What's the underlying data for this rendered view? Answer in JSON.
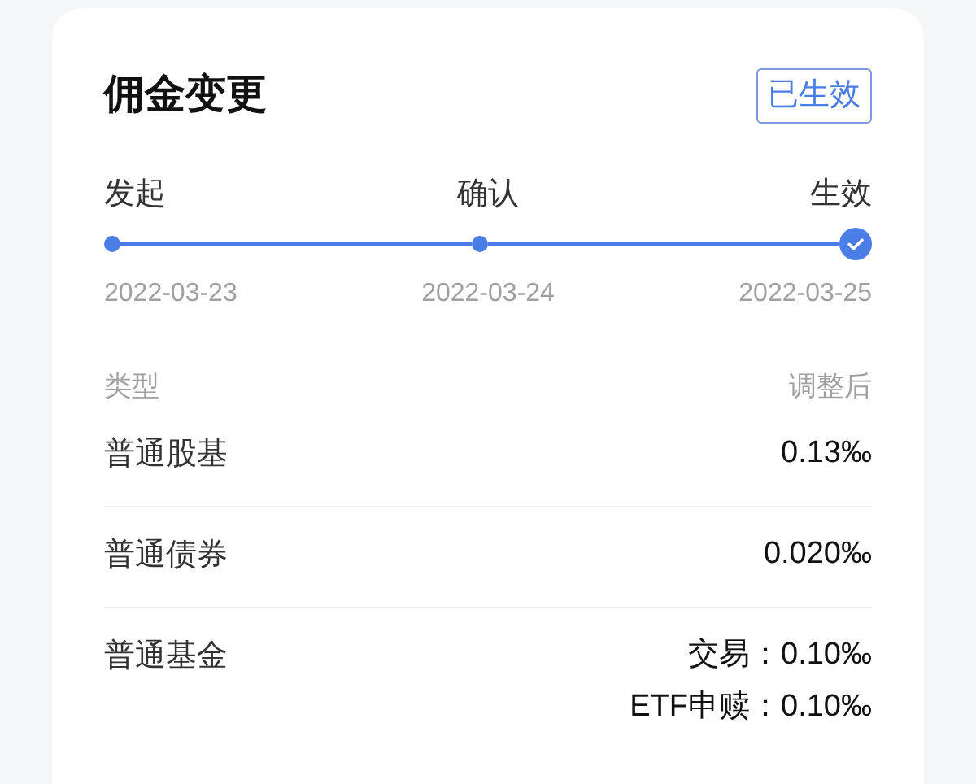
{
  "card": {
    "title": "佣金变更",
    "status_badge": "已生效"
  },
  "steps": [
    {
      "label": "发起",
      "date": "2022-03-23",
      "kind": "dot"
    },
    {
      "label": "确认",
      "date": "2022-03-24",
      "kind": "dot"
    },
    {
      "label": "生效",
      "date": "2022-03-25",
      "kind": "check"
    }
  ],
  "table": {
    "columns": [
      "类型",
      "调整后"
    ],
    "rows": [
      {
        "type": "普通股基",
        "values": [
          "0.13‰"
        ]
      },
      {
        "type": "普通债券",
        "values": [
          "0.020‰"
        ]
      },
      {
        "type": "普通基金",
        "values": [
          "交易：0.10‰",
          "ETF申赎：0.10‰"
        ]
      }
    ]
  }
}
